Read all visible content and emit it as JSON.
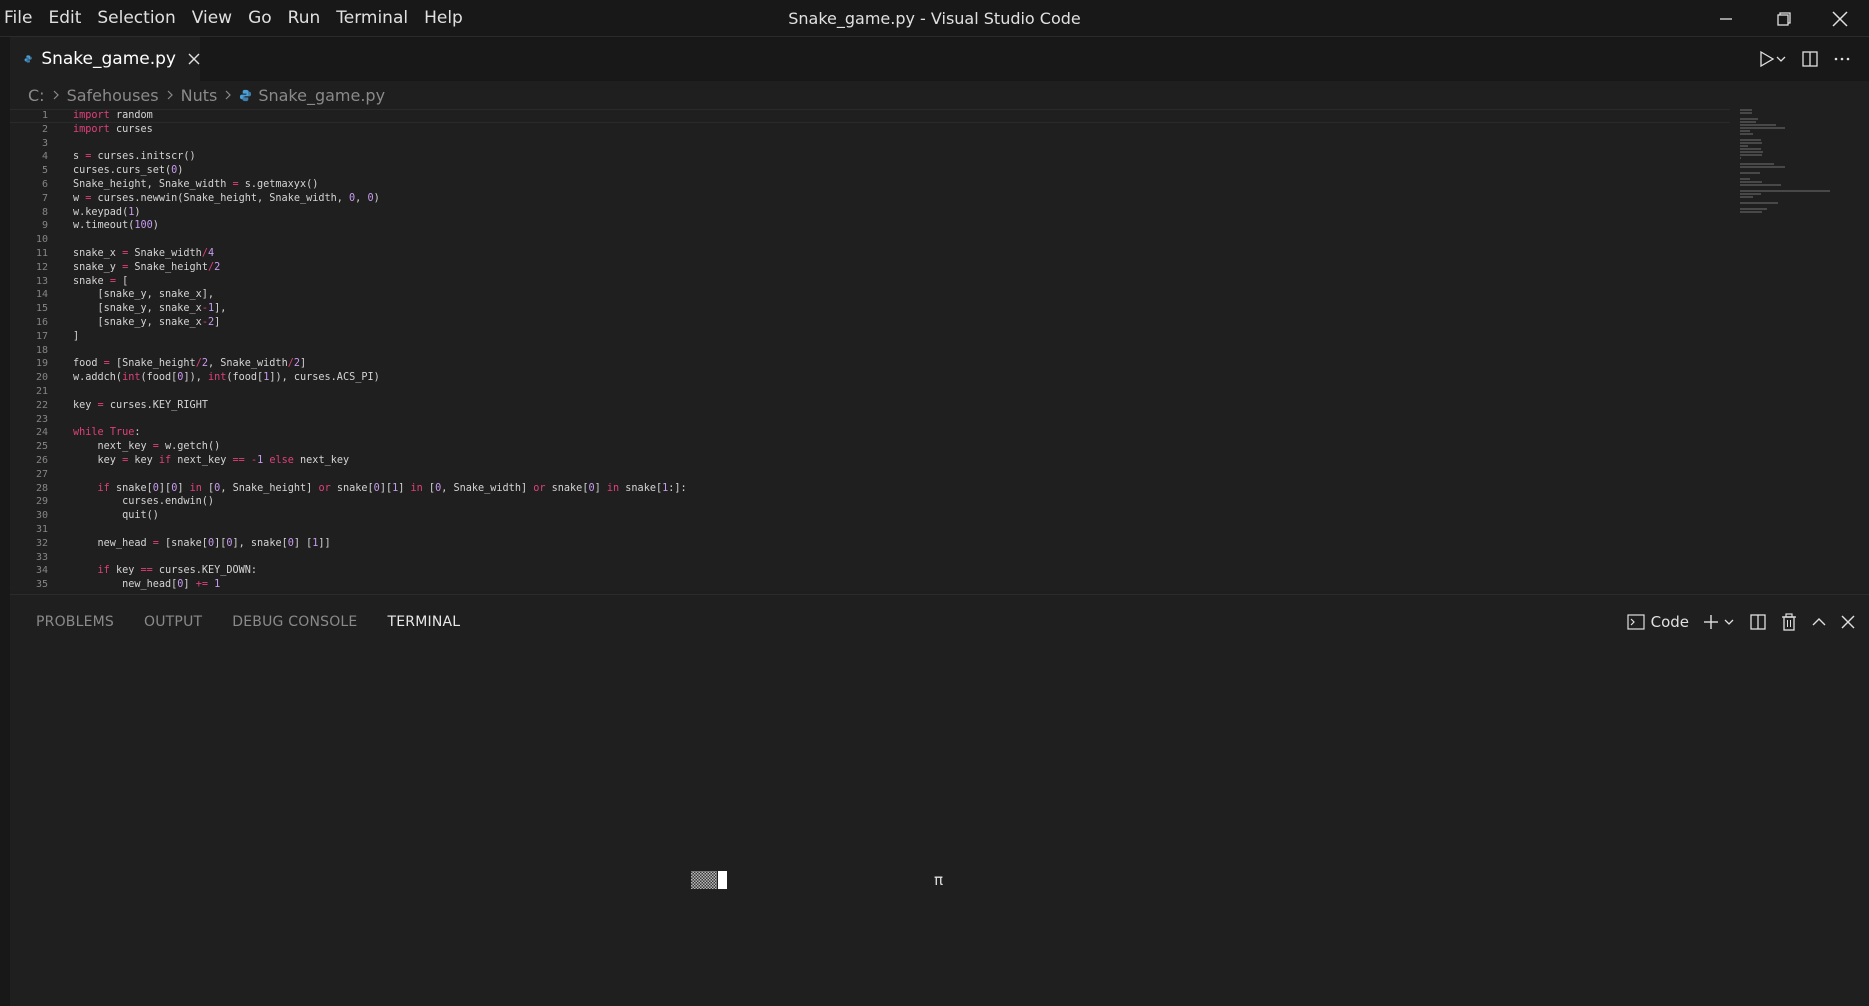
{
  "menu": [
    "File",
    "Edit",
    "Selection",
    "View",
    "Go",
    "Run",
    "Terminal",
    "Help"
  ],
  "window_title": "Snake_game.py - Visual Studio Code",
  "tab": {
    "label": "Snake_game.py"
  },
  "breadcrumb": [
    "C:",
    "Safehouses",
    "Nuts",
    "Snake_game.py"
  ],
  "line_numbers": [
    "1",
    "2",
    "3",
    "4",
    "5",
    "6",
    "7",
    "8",
    "9",
    "10",
    "11",
    "12",
    "13",
    "14",
    "15",
    "16",
    "17",
    "18",
    "19",
    "20",
    "21",
    "22",
    "23",
    "24",
    "25",
    "26",
    "27",
    "28",
    "29",
    "30",
    "31",
    "32",
    "33",
    "34",
    "35"
  ],
  "code": [
    "import random",
    "import curses",
    "",
    "s = curses.initscr()",
    "curses.curs_set(0)",
    "Snake_height, Snake_width = s.getmaxyx()",
    "w = curses.newwin(Snake_height, Snake_width, 0, 0)",
    "w.keypad(1)",
    "w.timeout(100)",
    "",
    "snake_x = Snake_width/4",
    "snake_y = Snake_height/2",
    "snake = [",
    "    [snake_y, snake_x],",
    "    [snake_y, snake_x-1],",
    "    [snake_y, snake_x-2]",
    "]",
    "",
    "food = [Snake_height/2, Snake_width/2]",
    "w.addch(int(food[0]), int(food[1]), curses.ACS_PI)",
    "",
    "key = curses.KEY_RIGHT",
    "",
    "while True:",
    "    next_key = w.getch()",
    "    key = key if next_key == -1 else next_key",
    "",
    "    if snake[0][0] in [0, Snake_height] or snake[0][1] in [0, Snake_width] or snake[0] in snake[1:]:",
    "        curses.endwin()",
    "        quit()",
    "",
    "    new_head = [snake[0][0], snake[0] [1]]",
    "",
    "    if key == curses.KEY_DOWN:",
    "        new_head[0] += 1"
  ],
  "panel": {
    "tabs": [
      "PROBLEMS",
      "OUTPUT",
      "DEBUG CONSOLE",
      "TERMINAL"
    ],
    "active_tab": "TERMINAL",
    "terminal_name": "Code"
  },
  "terminal": {
    "food_char": "π"
  },
  "colors": {
    "keyword": "#e0407b",
    "number": "#c89bf0",
    "background": "#1f1f1f",
    "python_icon": "#4a9fd8"
  }
}
